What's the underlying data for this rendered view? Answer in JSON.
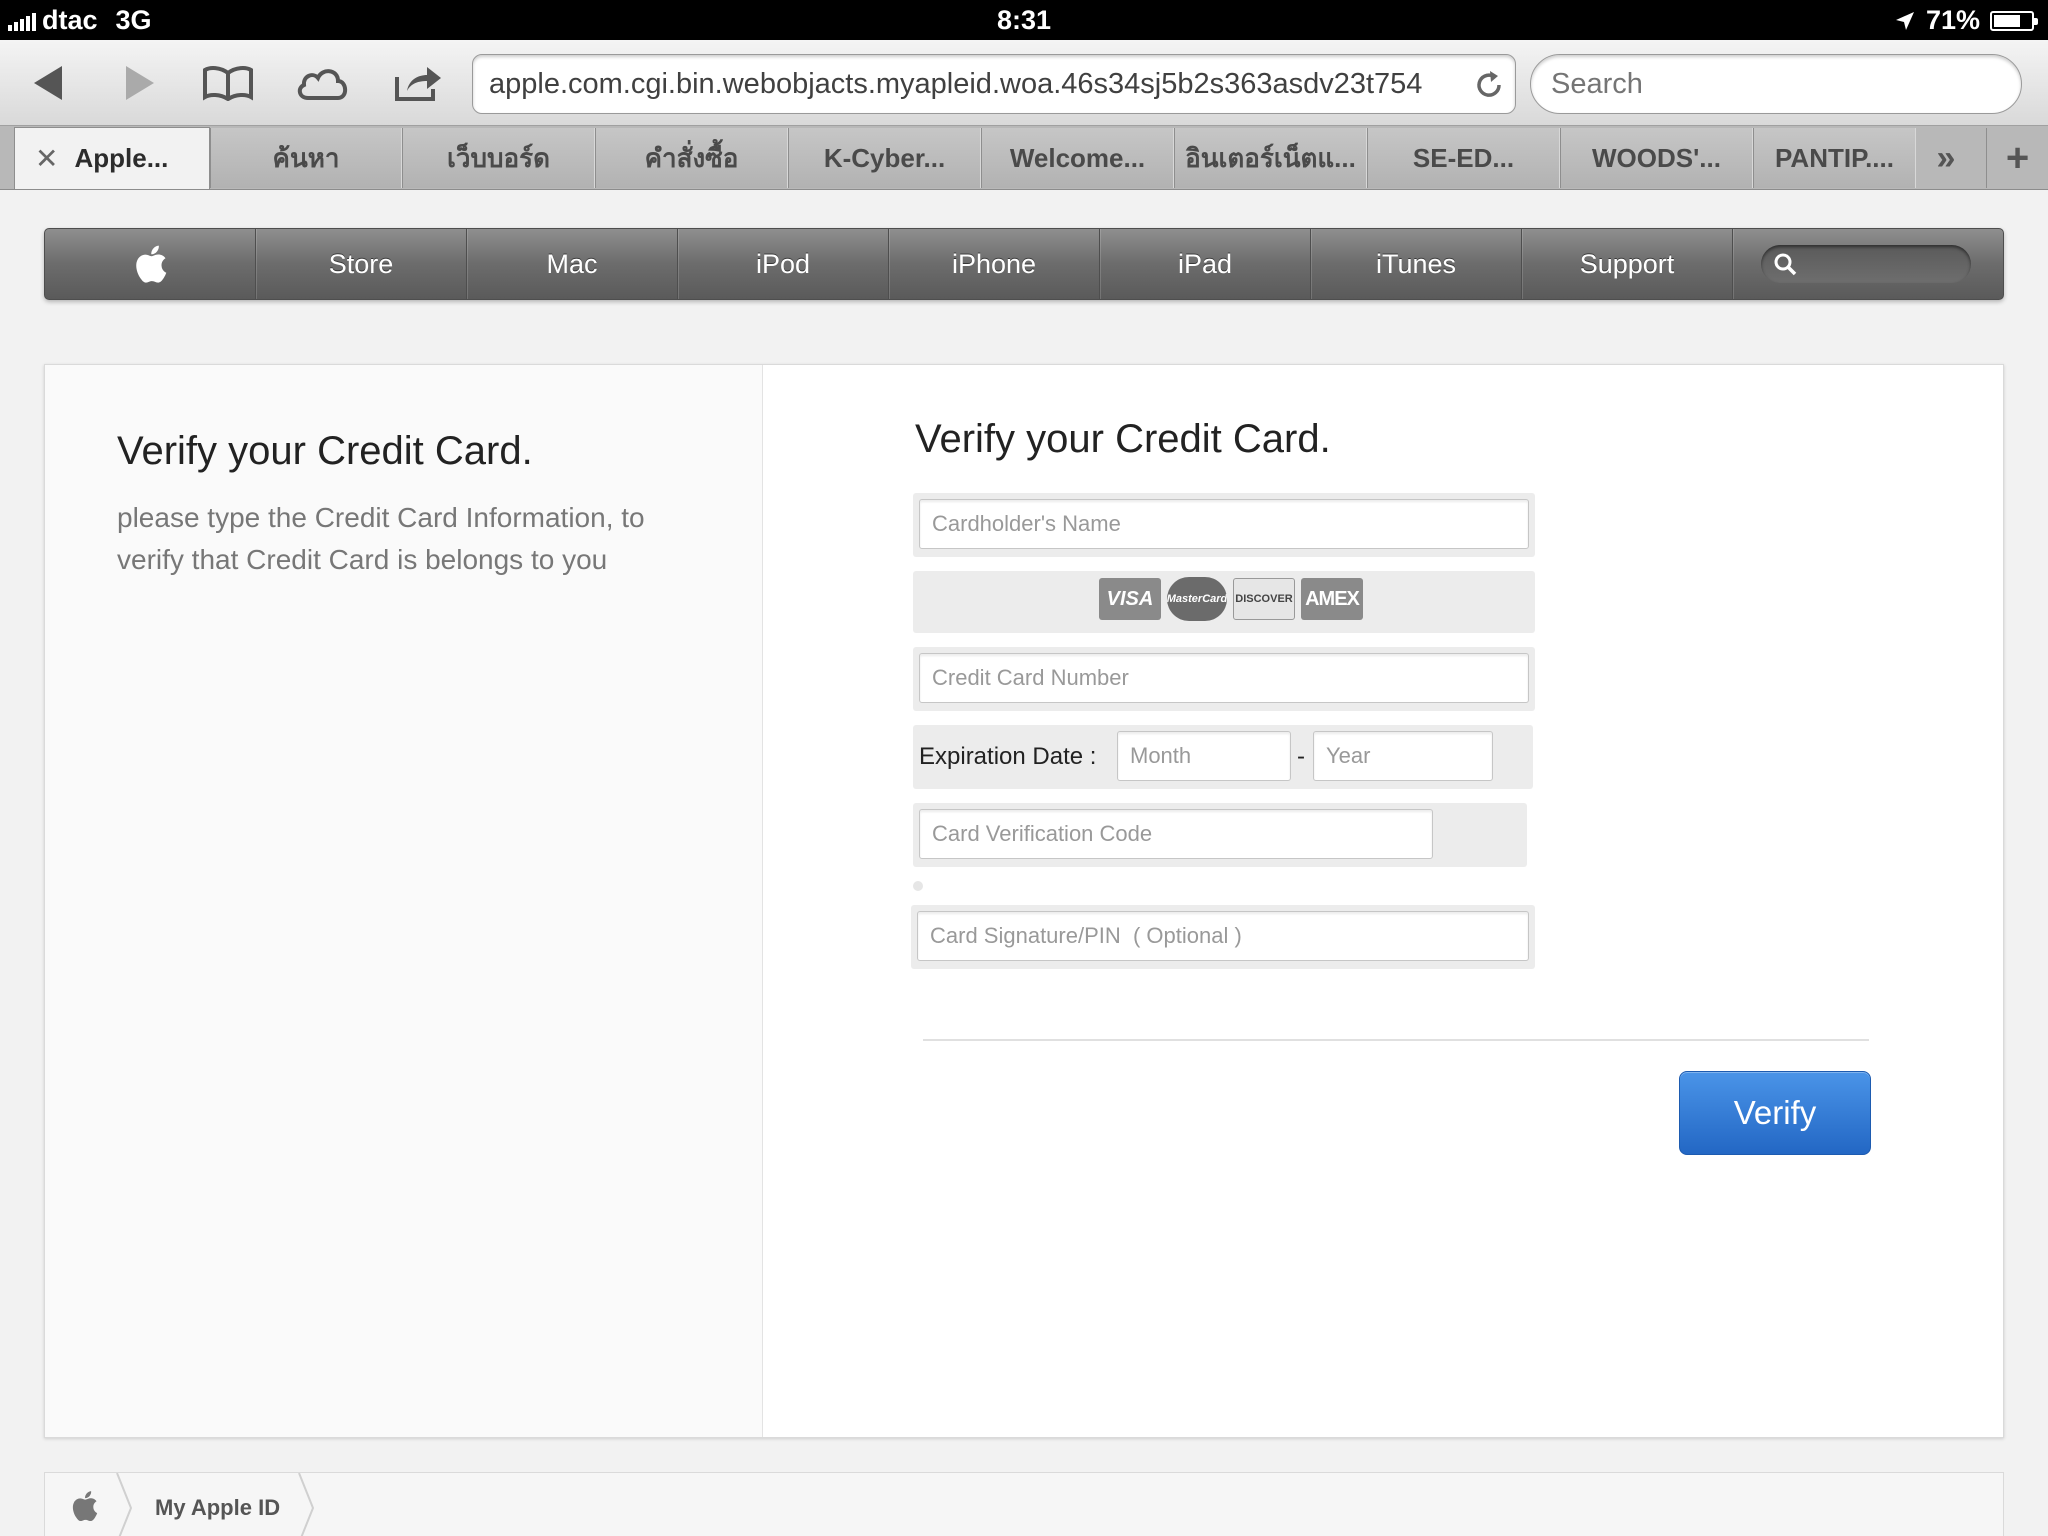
{
  "status": {
    "carrier": "dtac",
    "network": "3G",
    "time": "8:31",
    "battery": "71%",
    "battery_level": 0.71
  },
  "browser": {
    "url": "apple.com.cgi.bin.webobjacts.myapleid.woa.46s34sj5b2s363asdv23t754",
    "search_placeholder": "Search",
    "tabs": [
      {
        "label": "Apple..."
      },
      {
        "label": "ค้นหา"
      },
      {
        "label": "เว็บบอร์ด"
      },
      {
        "label": "คำสั่งซื้อ"
      },
      {
        "label": "K-Cyber..."
      },
      {
        "label": "Welcome..."
      },
      {
        "label": "อินเตอร์เน็ตแ..."
      },
      {
        "label": "SE-ED..."
      },
      {
        "label": "WOODS'..."
      },
      {
        "label": "PANTIP...."
      }
    ],
    "tab_more": "»",
    "tab_add": "+"
  },
  "nav": {
    "items": [
      "Store",
      "Mac",
      "iPod",
      "iPhone",
      "iPad",
      "iTunes",
      "Support"
    ]
  },
  "intro": {
    "title": "Verify your Credit Card.",
    "body": "please type the Credit Card Information, to verify that Credit Card is belongs to you"
  },
  "form": {
    "title": "Verify your Credit Card.",
    "cardholder_placeholder": "Cardholder's Name",
    "cards": [
      "VISA",
      "MasterCard",
      "DISCOVER",
      "AMEX"
    ],
    "number_placeholder": "Credit Card Number",
    "expiration_label": "Expiration Date  :",
    "month_placeholder": "Month",
    "dash": "-",
    "year_placeholder": "Year",
    "cvc_placeholder": "Card Verification Code",
    "pin_placeholder": "Card Signature/PIN  ( Optional )",
    "verify_label": "Verify"
  },
  "footer": {
    "breadcrumb": "My Apple ID"
  }
}
